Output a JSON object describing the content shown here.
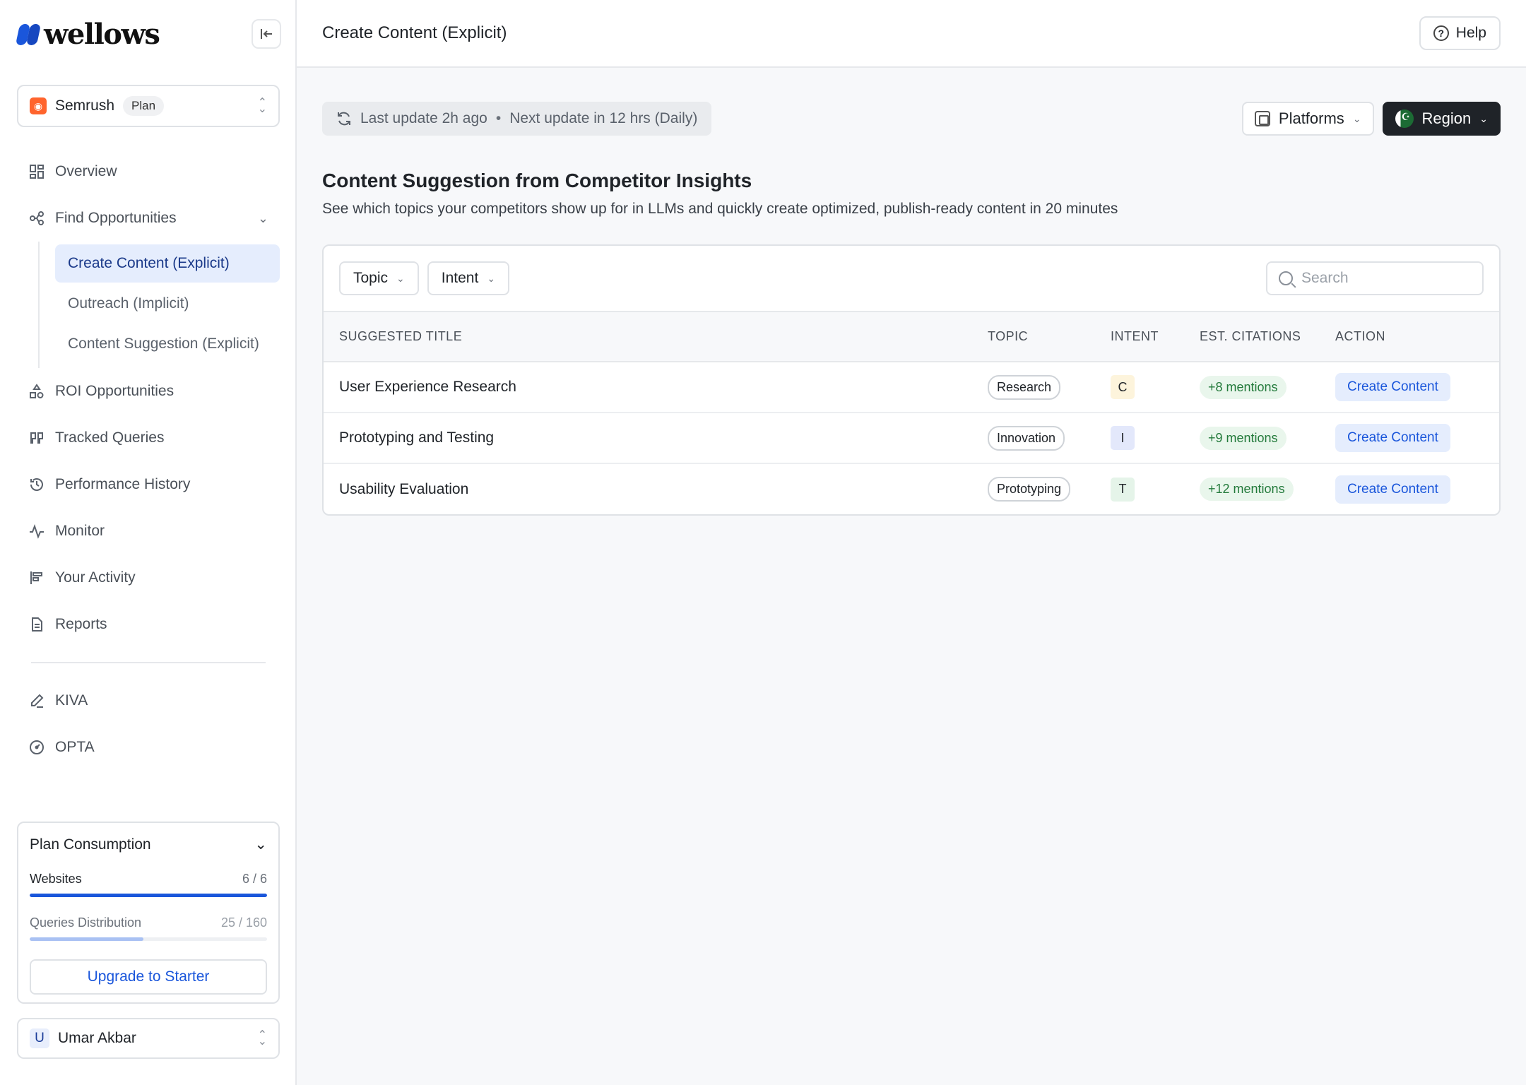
{
  "brand": {
    "name": "wellows",
    "color": "#1a56db"
  },
  "workspace": {
    "icon": "semrush-icon",
    "name": "Semrush",
    "badge": "Plan"
  },
  "nav": {
    "overview": "Overview",
    "find_opportunities": "Find Opportunities",
    "sub": [
      "Create Content (Explicit)",
      "Outreach (Implicit)",
      "Content Suggestion (Explicit)"
    ],
    "roi": "ROI Opportunities",
    "tracked": "Tracked Queries",
    "performance": "Performance History",
    "monitor": "Monitor",
    "activity": "Your Activity",
    "reports": "Reports",
    "kiva": "KIVA",
    "opta": "OPTA"
  },
  "plan": {
    "title": "Plan Consumption",
    "websites_label": "Websites",
    "websites_value": "6 / 6",
    "websites_progress": 1.0,
    "queries_label": "Queries Distribution",
    "queries_value": "25 / 160",
    "queries_progress": 0.48,
    "upgrade_label": "Upgrade to Starter"
  },
  "user": {
    "initial": "U",
    "name": "Umar Akbar"
  },
  "header": {
    "title": "Create Content (Explicit)",
    "help": "Help"
  },
  "status": {
    "last_update": "Last update 2h ago",
    "separator": "•",
    "next_update": "Next update in 12 hrs (Daily)"
  },
  "controls": {
    "platforms": "Platforms",
    "region": "Region"
  },
  "section": {
    "title": "Content Suggestion from Competitor Insights",
    "subtitle": "See which topics your competitors show up for in LLMs and quickly create optimized, publish-ready content in 20 minutes"
  },
  "filters": {
    "topic": "Topic",
    "intent": "Intent",
    "search_placeholder": "Search"
  },
  "table": {
    "headers": {
      "title": "SUGGESTED TITLE",
      "topic": "TOPIC",
      "intent": "INTENT",
      "citations": "EST. CITATIONS",
      "action": "ACTION"
    },
    "rows": [
      {
        "title": "User Experience Research",
        "topic": "Research",
        "intent": "C",
        "intent_bg": "#fdf4dc",
        "citations": "+8 mentions",
        "action": "Create Content"
      },
      {
        "title": "Prototyping and Testing",
        "topic": "Innovation",
        "intent": "I",
        "intent_bg": "#e3e8fb",
        "citations": "+9 mentions",
        "action": "Create Content"
      },
      {
        "title": "Usability Evaluation",
        "topic": "Prototyping",
        "intent": "T",
        "intent_bg": "#e5f4e9",
        "citations": "+12 mentions",
        "action": "Create Content"
      }
    ]
  }
}
